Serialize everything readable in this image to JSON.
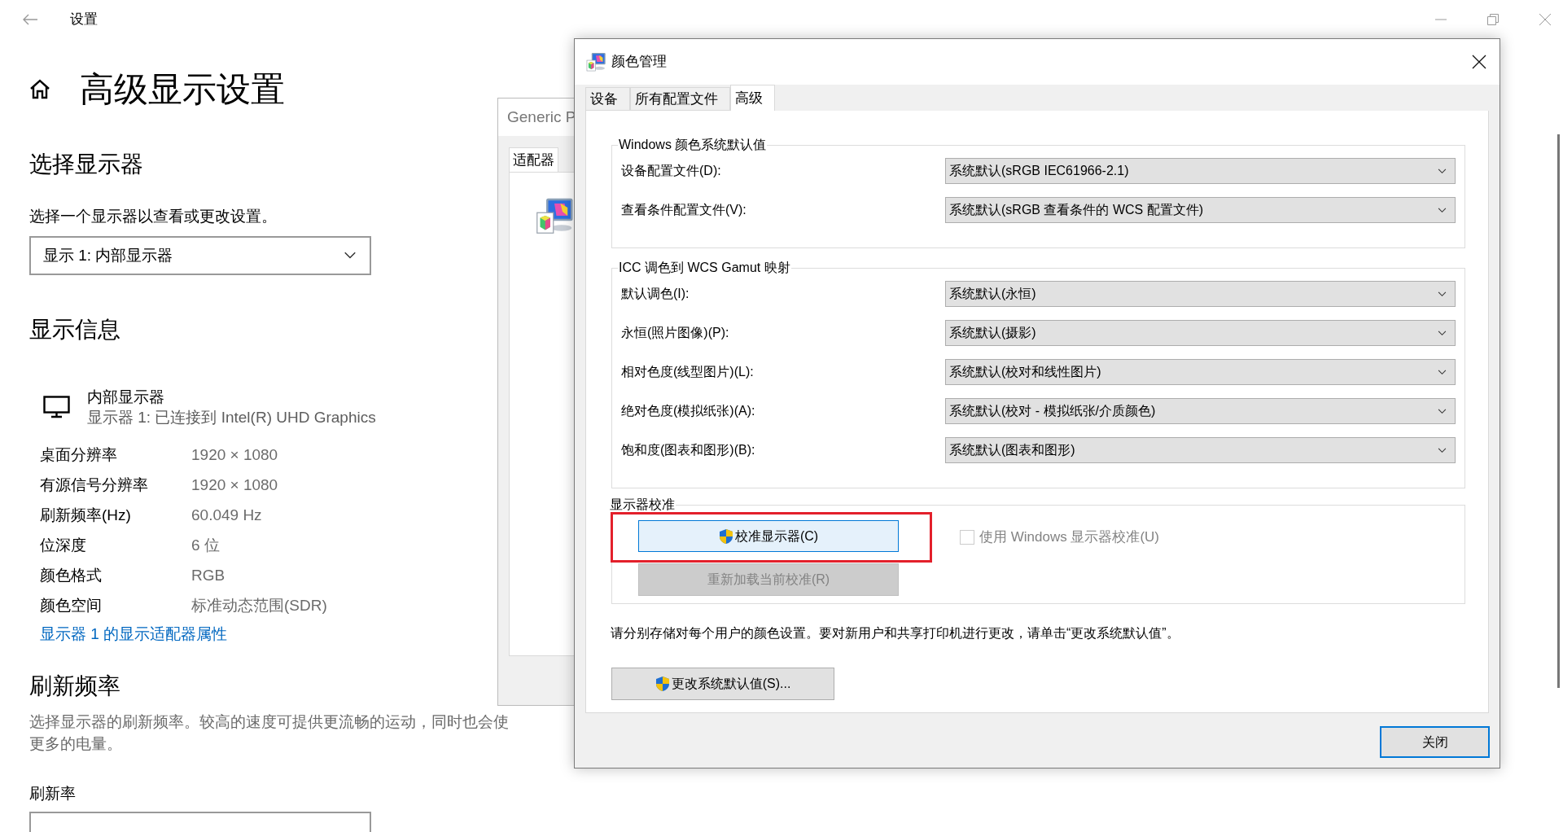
{
  "settings_window": {
    "title": "设置",
    "heading": "高级显示设置",
    "select_display": {
      "heading": "选择显示器",
      "description": "选择一个显示器以查看或更改设置。",
      "dropdown": {
        "value": "显示 1: 内部显示器"
      }
    },
    "display_info": {
      "heading": "显示信息",
      "monitor": {
        "name": "内部显示器",
        "subtitle": "显示器 1: 已连接到 Intel(R) UHD Graphics"
      },
      "rows": [
        {
          "label": "桌面分辨率",
          "value": "1920 × 1080"
        },
        {
          "label": "有源信号分辨率",
          "value": "1920 × 1080"
        },
        {
          "label": "刷新频率(Hz)",
          "value": "60.049 Hz"
        },
        {
          "label": "位深度",
          "value": "6 位"
        },
        {
          "label": "颜色格式",
          "value": "RGB"
        },
        {
          "label": "颜色空间",
          "value": "标准动态范围(SDR)"
        }
      ],
      "link": "显示器 1 的显示适配器属性"
    },
    "refresh": {
      "heading": "刷新频率",
      "description": "选择显示器的刷新频率。较高的速度可提供更流畅的运动，同时也会使",
      "description_2": "更多的电量。",
      "field_label": "刷新率"
    }
  },
  "adapter_window": {
    "title": "Generic P",
    "tabs": [
      {
        "label": "适配器",
        "selected": true
      }
    ]
  },
  "color_dialog": {
    "title": "颜色管理",
    "tabs": [
      {
        "label": "设备",
        "selected": false
      },
      {
        "label": "所有配置文件",
        "selected": false
      },
      {
        "label": "高级",
        "selected": true
      }
    ],
    "groups": [
      {
        "legend": "Windows 颜色系统默认值",
        "rows": [
          {
            "label": "设备配置文件(D):",
            "value": "系统默认(sRGB IEC61966-2.1)"
          },
          {
            "label": "查看条件配置文件(V):",
            "value": "系统默认(sRGB 查看条件的 WCS 配置文件)"
          }
        ]
      },
      {
        "legend": "ICC 调色到 WCS Gamut 映射",
        "rows": [
          {
            "label": "默认调色(I):",
            "value": "系统默认(永恒)"
          },
          {
            "label": "永恒(照片图像)(P):",
            "value": "系统默认(摄影)"
          },
          {
            "label": "相对色度(线型图片)(L):",
            "value": "系统默认(校对和线性图片)"
          },
          {
            "label": "绝对色度(模拟纸张)(A):",
            "value": "系统默认(校对 - 模拟纸张/介质颜色)"
          },
          {
            "label": "饱和度(图表和图形)(B):",
            "value": "系统默认(图表和图形)"
          }
        ]
      }
    ],
    "calibration": {
      "legend": "显示器校准",
      "calibrate_button": {
        "label": "校准显示器(C)",
        "highlighted": true
      },
      "reload_button": {
        "label": "重新加载当前校准(R)",
        "disabled": true
      },
      "use_windows_checkbox": {
        "label": "使用 Windows 显示器校准(U)",
        "checked": false,
        "disabled": true
      }
    },
    "note": "请分别存储对每个用户的颜色设置。要对新用户和共享打印机进行更改，请单击“更改系统默认值”。",
    "change_defaults_button": {
      "label": "更改系统默认值(S)..."
    },
    "close_button": {
      "label": "关闭"
    }
  }
}
